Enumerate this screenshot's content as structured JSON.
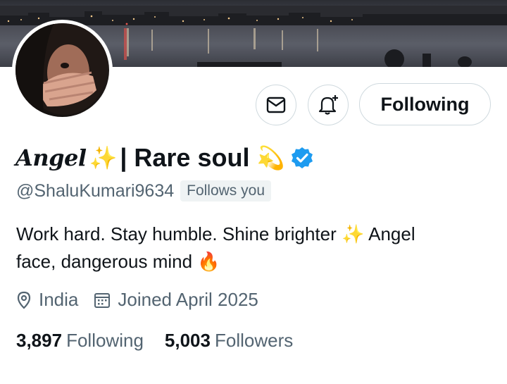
{
  "profile": {
    "name_script": "Angel",
    "name_sparkle": "✨",
    "name_rest": "| Rare soul",
    "name_emoji": "💫",
    "verified_color": "#1d9bf0",
    "handle": "@ShaluKumari9634",
    "follows_you": "Follows you",
    "bio_line1": "Work hard. Stay humble. Shine brighter ✨  Angel",
    "bio_line2": "face, dangerous mind 🔥",
    "location": "India",
    "joined": "Joined April 2025",
    "following_count": "3,897",
    "following_label": "Following",
    "followers_count": "5,003",
    "followers_label": "Followers"
  },
  "actions": {
    "message_icon": "envelope-icon",
    "notify_icon": "bell-plus-icon",
    "following_button": "Following"
  },
  "colors": {
    "text_primary": "#0f1419",
    "text_secondary": "#536471",
    "border": "#cfd9de",
    "badge_bg": "#eff3f4"
  }
}
